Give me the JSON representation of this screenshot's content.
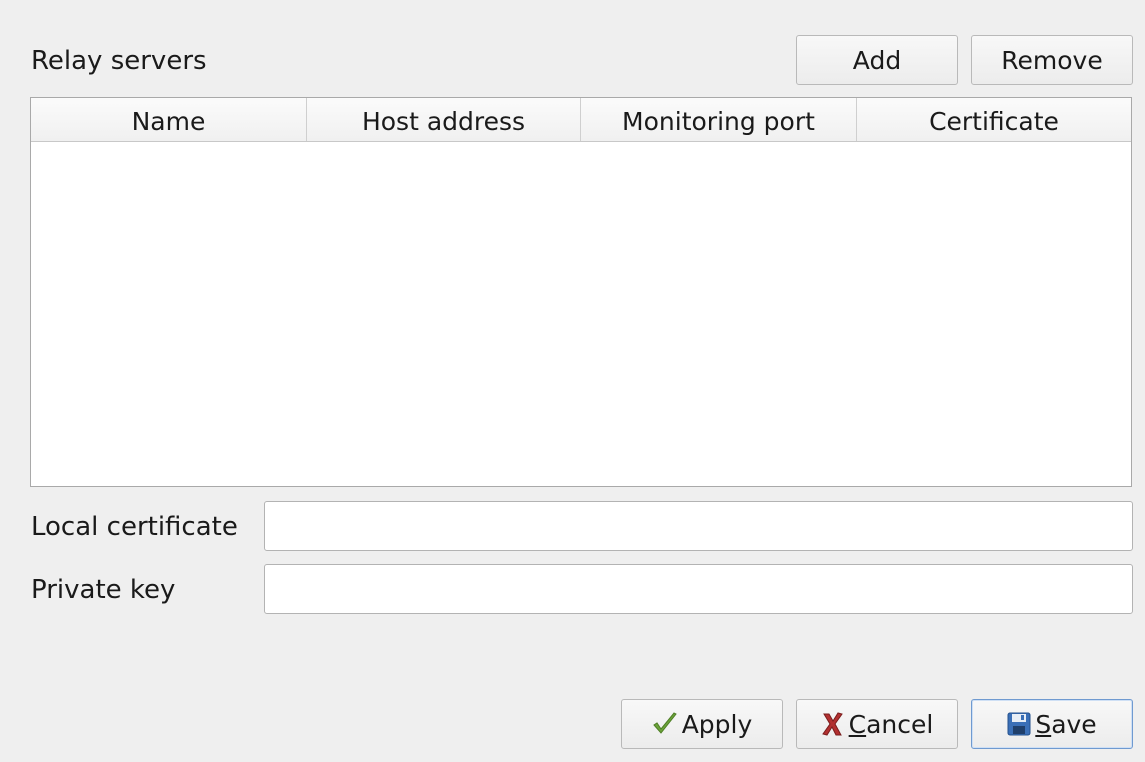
{
  "relay": {
    "section_label": "Relay servers",
    "add_label": "Add",
    "remove_label": "Remove"
  },
  "table": {
    "columns": [
      "Name",
      "Host address",
      "Monitoring port",
      "Certificate"
    ],
    "rows": []
  },
  "form": {
    "local_certificate_label": "Local certificate",
    "local_certificate_value": "",
    "private_key_label": "Private key",
    "private_key_value": ""
  },
  "footer": {
    "apply_label": "Apply",
    "cancel_first": "C",
    "cancel_rest": "ancel",
    "save_first": "S",
    "save_rest": "ave"
  },
  "icons": {
    "apply": "checkmark-icon",
    "cancel": "red-x-icon",
    "save": "floppy-disk-icon"
  },
  "colors": {
    "apply_icon": "#6ca33a",
    "cancel_icon": "#b23030",
    "save_icon": "#3a6fb7",
    "default_button_border": "#6f9ad0"
  }
}
